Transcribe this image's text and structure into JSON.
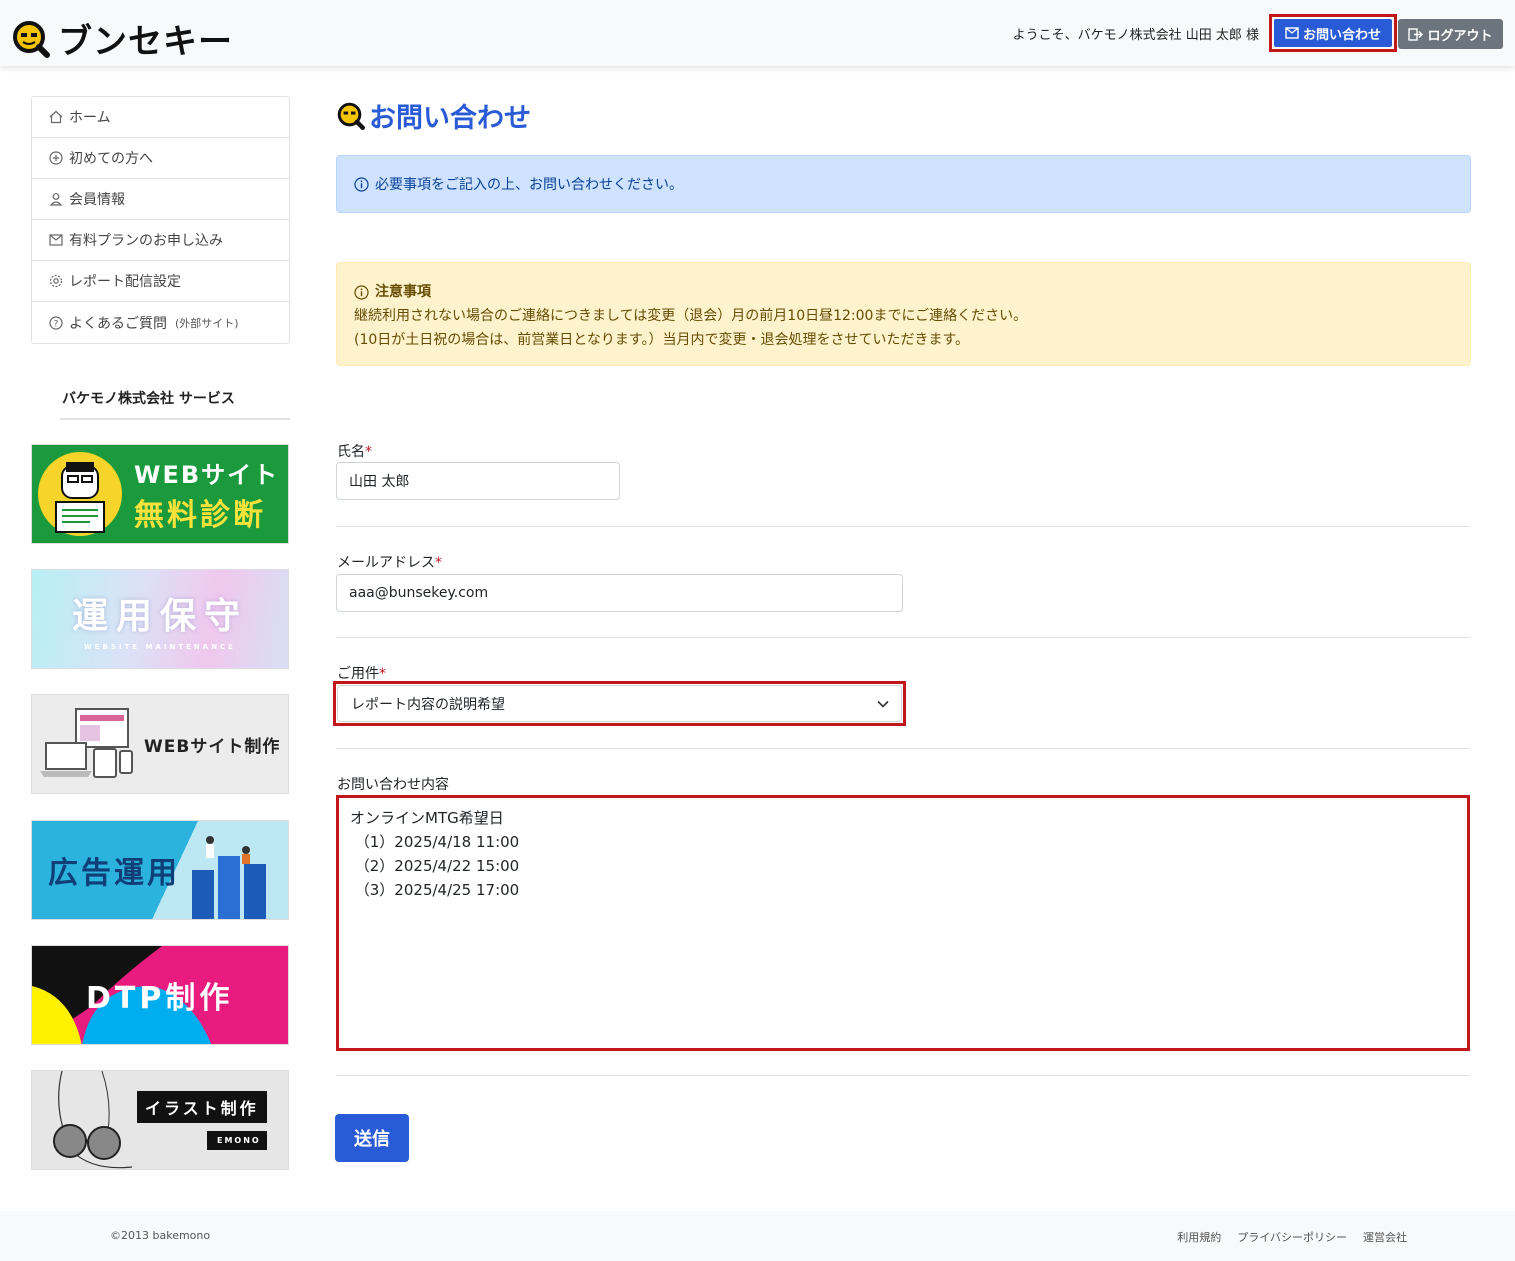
{
  "header": {
    "logo_text": "ブンセキー",
    "welcome": "ようこそ、バケモノ株式会社 山田 太郎 様",
    "contact_button": "お問い合わせ",
    "logout_button": "ログアウト"
  },
  "sidebar": {
    "items": [
      {
        "label": "ホーム",
        "icon": "home-icon"
      },
      {
        "label": "初めての方へ",
        "icon": "plus-circle-icon"
      },
      {
        "label": "会員情報",
        "icon": "person-icon"
      },
      {
        "label": "有料プランのお申し込み",
        "icon": "envelope-icon"
      },
      {
        "label": "レポート配信設定",
        "icon": "gear-icon"
      },
      {
        "label": "よくあるご質問",
        "suffix": "(外部サイト)",
        "icon": "question-circle-icon"
      }
    ],
    "service_title": "バケモノ株式会社 サービス",
    "banners": [
      {
        "line1": "WEBサイト",
        "line2": "無料診断"
      },
      {
        "line1": "運用保守",
        "line2": "WEBSITE MAINTENANCE"
      },
      {
        "line1": "WEBサイト制作"
      },
      {
        "line1": "広告運用"
      },
      {
        "line1": "DTP制作"
      },
      {
        "line1": "イラスト制作",
        "line2": "EMONO"
      }
    ]
  },
  "main": {
    "title": "お問い合わせ",
    "info_alert": "必要事項をご記入の上、お問い合わせください。",
    "notice": {
      "heading": "注意事項",
      "line1": "継続利用されない場合のご連絡につきましては変更（退会）月の前月10日昼12:00までにご連絡ください。",
      "line2": "(10日が土日祝の場合は、前営業日となります。）当月内で変更・退会処理をさせていただきます。"
    },
    "form": {
      "name_label": "氏名",
      "name_value": "山田 太郎",
      "email_label": "メールアドレス",
      "email_value": "aaa@bunsekey.com",
      "subject_label": "ご用件",
      "subject_value": "レポート内容の説明希望",
      "body_label": "お問い合わせ内容",
      "body_value": "オンラインMTG希望日\n （1）2025/4/18 11:00\n （2）2025/4/22 15:00\n （3）2025/4/25 17:00",
      "required_mark": "*",
      "submit": "送信"
    }
  },
  "footer": {
    "copyright": "©2013 bakemono",
    "links": [
      "利用規約",
      "プライバシーポリシー",
      "運営会社"
    ]
  },
  "colors": {
    "accent": "#2a5bd7",
    "highlight_border": "#c0161c",
    "info_bg": "#cfe2ff",
    "warn_bg": "#fff3cd"
  }
}
